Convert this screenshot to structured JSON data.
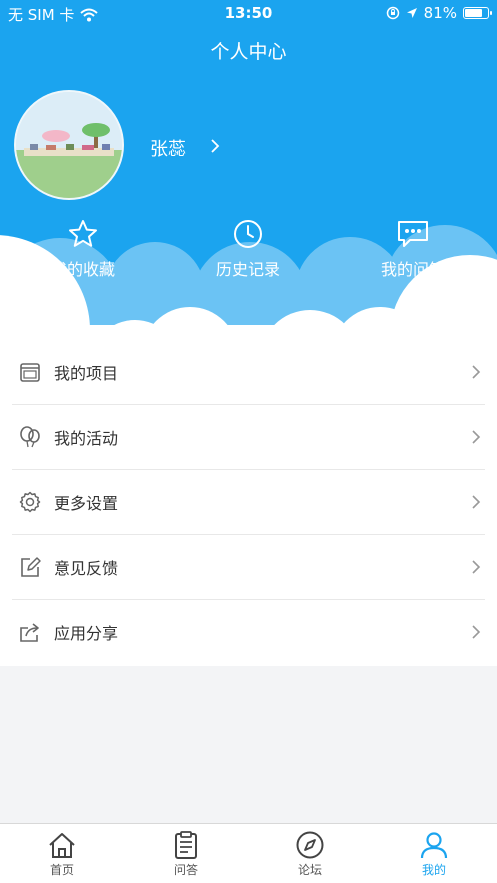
{
  "status_bar": {
    "carrier": "无 SIM 卡",
    "time": "13:50",
    "battery": "81%",
    "battery_level": 0.81
  },
  "header": {
    "title": "个人中心",
    "user_name": "张蕊"
  },
  "quick_actions": [
    {
      "label": "我的收藏",
      "icon": "star-icon"
    },
    {
      "label": "历史记录",
      "icon": "clock-icon"
    },
    {
      "label": "我的问答",
      "icon": "chat-icon"
    }
  ],
  "menu": [
    {
      "label": "我的项目",
      "icon": "project-icon"
    },
    {
      "label": "我的活动",
      "icon": "balloon-icon"
    },
    {
      "label": "更多设置",
      "icon": "gear-icon"
    },
    {
      "label": "意见反馈",
      "icon": "edit-icon"
    },
    {
      "label": "应用分享",
      "icon": "share-icon"
    }
  ],
  "tabbar": [
    {
      "label": "首页",
      "icon": "home-icon",
      "active": false
    },
    {
      "label": "问答",
      "icon": "clipboard-icon",
      "active": false
    },
    {
      "label": "论坛",
      "icon": "compass-icon",
      "active": false
    },
    {
      "label": "我的",
      "icon": "person-icon",
      "active": true
    }
  ],
  "colors": {
    "accent": "#1ba4ef",
    "background": "#f3f4f6"
  }
}
